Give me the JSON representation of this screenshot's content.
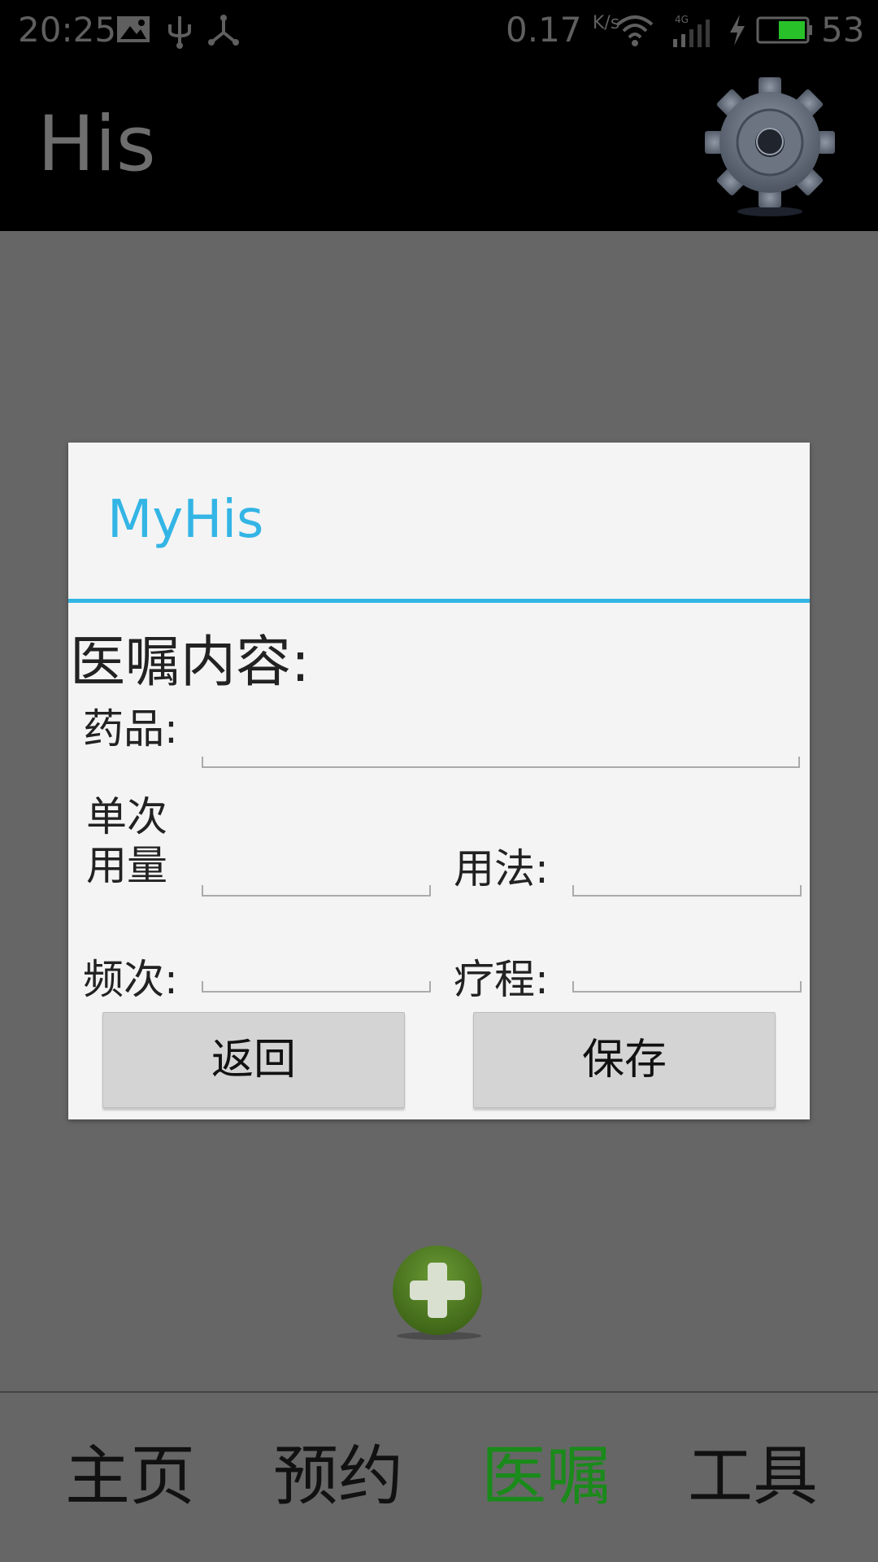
{
  "status_bar": {
    "time": "20:25",
    "net_speed": "0.17",
    "net_speed_unit": "K/s",
    "network_type": "4G",
    "battery_level": "53",
    "icons": [
      "image-icon",
      "usb-icon",
      "share-icon",
      "wifi-icon",
      "signal-icon",
      "charging-icon",
      "battery-icon"
    ]
  },
  "action_bar": {
    "title": "His",
    "settings_icon": "gear-icon"
  },
  "dialog": {
    "title": "MyHis",
    "accent_color": "#33b5e5",
    "section_heading": "医嘱内容:",
    "fields": {
      "drug_label": "药品:",
      "dose_label_line1": "单次",
      "dose_label_line2": "用量",
      "usage_label": "用法:",
      "frequency_label": "频次:",
      "course_label": "疗程:"
    },
    "values": {
      "drug": "",
      "dose": "",
      "usage": "",
      "frequency": "",
      "course": ""
    },
    "buttons": {
      "back": "返回",
      "save": "保存"
    }
  },
  "fab": {
    "icon": "plus-icon",
    "color": "#4b7a1d"
  },
  "bottom_nav": {
    "items": [
      {
        "label": "主页",
        "active": false
      },
      {
        "label": "预约",
        "active": false
      },
      {
        "label": "医嘱",
        "active": true
      },
      {
        "label": "工具",
        "active": false
      }
    ],
    "active_color": "#1a8a1a"
  }
}
